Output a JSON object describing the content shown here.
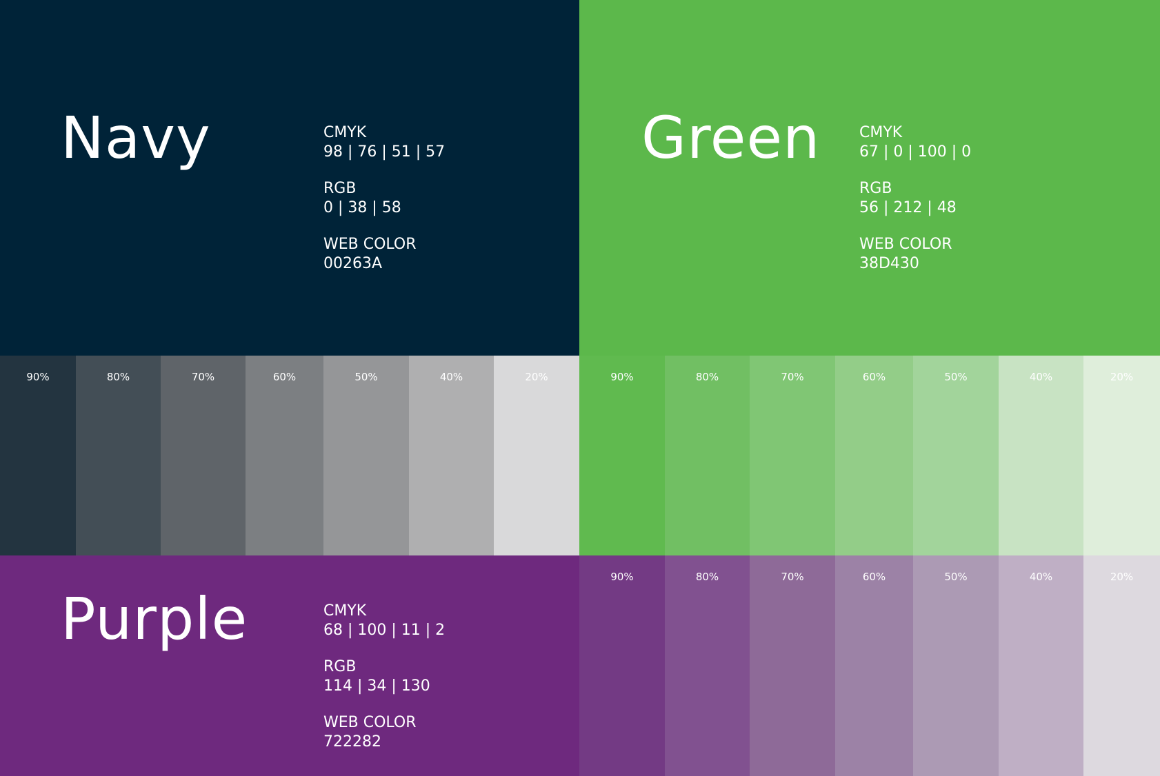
{
  "colors": [
    {
      "name": "Navy",
      "cmyk_label": "CMYK",
      "cmyk": "98 | 76 | 51 | 57",
      "rgb_label": "RGB",
      "rgb": "0 | 38 | 58",
      "web_label": "WEB COLOR",
      "web": "00263A",
      "base_hex": "#002338",
      "tints": [
        {
          "label": "90%",
          "color": "#233440"
        },
        {
          "label": "80%",
          "color": "#434e56"
        },
        {
          "label": "70%",
          "color": "#5f6469"
        },
        {
          "label": "60%",
          "color": "#7c7f82"
        },
        {
          "label": "50%",
          "color": "#959698"
        },
        {
          "label": "40%",
          "color": "#afafb0"
        },
        {
          "label": "20%",
          "color": "#d9d9da"
        }
      ]
    },
    {
      "name": "Green",
      "cmyk_label": "CMYK",
      "cmyk": "67 | 0 | 100 | 0",
      "rgb_label": "RGB",
      "rgb": "56 | 212 | 48",
      "web_label": "WEB COLOR",
      "web": "38D430",
      "base_hex": "#5cb84b",
      "tints": [
        {
          "label": "90%",
          "color": "#60ba4f"
        },
        {
          "label": "80%",
          "color": "#71bf63"
        },
        {
          "label": "70%",
          "color": "#80c674"
        },
        {
          "label": "60%",
          "color": "#93cd88"
        },
        {
          "label": "50%",
          "color": "#a2d49b"
        },
        {
          "label": "40%",
          "color": "#c8e3c3"
        },
        {
          "label": "20%",
          "color": "#dfeedb"
        }
      ]
    },
    {
      "name": "Purple",
      "cmyk_label": "CMYK",
      "cmyk": "68 | 100 | 11 | 2",
      "rgb_label": "RGB",
      "rgb": "114 | 34 | 130",
      "web_label": "WEB COLOR",
      "web": "722282",
      "base_hex": "#6e297e",
      "tints": [
        {
          "label": "90%",
          "color": "#733a84"
        },
        {
          "label": "80%",
          "color": "#815190"
        },
        {
          "label": "70%",
          "color": "#8e6a98"
        },
        {
          "label": "60%",
          "color": "#9c82a6"
        },
        {
          "label": "50%",
          "color": "#ac9ab4"
        },
        {
          "label": "40%",
          "color": "#bfafc5"
        },
        {
          "label": "20%",
          "color": "#ddd9df"
        }
      ]
    }
  ]
}
